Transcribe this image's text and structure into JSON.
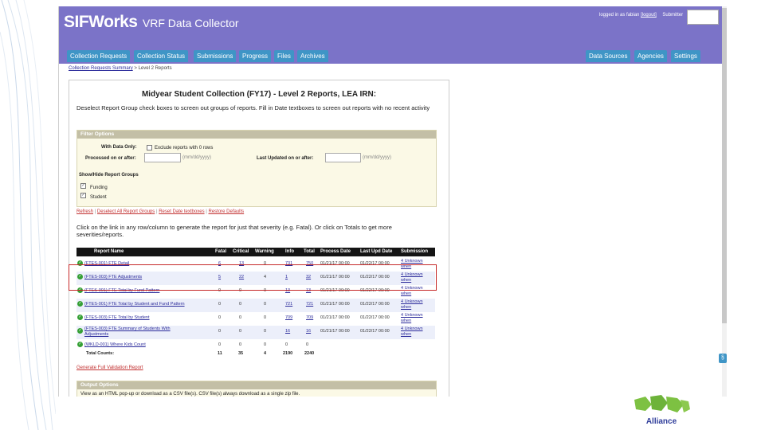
{
  "header": {
    "logo_main": "SIFWorks",
    "logo_sub": "VRF Data Collector",
    "login_prefix": "logged in as",
    "login_user": "fabian",
    "logout_label": "[logout]",
    "submitter_label": "Submitter"
  },
  "nav_left": [
    "Collection Requests",
    "Collection Status",
    "Submissions",
    "Progress",
    "Files",
    "Archives"
  ],
  "nav_right": [
    "Data Sources",
    "Agencies",
    "Settings"
  ],
  "breadcrumb": {
    "link": "Collection Requests Summary",
    "separator": ">",
    "current": "Level 2 Reports"
  },
  "page": {
    "title": "Midyear Student Collection (FY17) - Level 2 Reports, LEA IRN:",
    "intro": "Deselect Report Group check boxes to screen out groups of reports. Fill in Date textboxes to screen out reports with no recent activity"
  },
  "filter": {
    "heading": "Filter Options",
    "with_data_label": "With Data Only:",
    "exclude_label": "Exclude reports with 0 rows",
    "processed_label": "Processed on or after:",
    "date_hint": "(mm/dd/yyyy)",
    "updated_label": "Last Updated on or after:",
    "groups_label": "Show/Hide Report Groups",
    "group_funding": "Funding",
    "group_student": "Student"
  },
  "actions": [
    "Refresh",
    "Deselect All Report Groups",
    "Reset Date textboxes",
    "Restore Defaults"
  ],
  "action_separator": "|",
  "instructions": "Click on the link in any row/column to generate the report for just that severity (e.g. Fatal). Or click on Totals to get more severities/reports.",
  "table": {
    "headers": [
      "Report Name",
      "Fatal",
      "Critical",
      "Warning",
      "Info",
      "Total",
      "Process Date",
      "Last Upd Date",
      "Submission"
    ],
    "rows": [
      {
        "name": "(FTES-001) FTE Detail",
        "fatal": "6",
        "critical": "13",
        "warning": "0",
        "info": "731",
        "total": "750",
        "process": "01/21/17 00:00",
        "updated": "01/22/17 00:00",
        "submission": "4 Unknown",
        "submission2": "when"
      },
      {
        "name": "(FTES-003) FTE Adjustments",
        "fatal": "5",
        "critical": "22",
        "warning": "4",
        "info": "1",
        "total": "32",
        "process": "01/21/17 00:00",
        "updated": "01/22/17 00:00",
        "submission": "4 Unknown",
        "submission2": "when"
      },
      {
        "name": "(FTES-001) FTE Total by Fund Pattern",
        "fatal": "0",
        "critical": "0",
        "warning": "0",
        "info": "13",
        "total": "13",
        "process": "01/21/17 00:00",
        "updated": "01/22/17 00:00",
        "submission": "4 Unknown",
        "submission2": "when"
      },
      {
        "name": "(FTES-001) FTE Total by Student and Fund Pattern",
        "fatal": "0",
        "critical": "0",
        "warning": "0",
        "info": "721",
        "total": "721",
        "process": "01/21/17 00:00",
        "updated": "01/22/17 00:00",
        "submission": "4 Unknown",
        "submission2": "when"
      },
      {
        "name": "(FTES-003) FTE Total by Student",
        "fatal": "0",
        "critical": "0",
        "warning": "0",
        "info": "709",
        "total": "709",
        "process": "01/21/17 00:00",
        "updated": "01/22/17 00:00",
        "submission": "4 Unknown",
        "submission2": "when"
      },
      {
        "name": "(FTES-003) FTE Summary of Students With",
        "name2": "Adjustments",
        "fatal": "0",
        "critical": "0",
        "warning": "0",
        "info": "16",
        "total": "16",
        "process": "01/21/17 00:00",
        "updated": "01/22/17 00:00",
        "submission": "4 Unknown",
        "submission2": "when"
      },
      {
        "name": "(WKLD-001) Where Kids Count",
        "fatal": "0",
        "critical": "0",
        "warning": "0",
        "info": "0",
        "total": "0",
        "process": "",
        "updated": "",
        "submission": "",
        "submission2": ""
      }
    ],
    "totals": {
      "label": "Total Counts:",
      "fatal": "11",
      "critical": "35",
      "warning": "4",
      "info": "2190",
      "total": "2240"
    }
  },
  "generate_link": "Generate Full Validation Report",
  "output": {
    "heading": "Output Options",
    "description": "View as an HTML pop-up or download as a CSV file(s). CSV file(s) always download as a single zip file."
  },
  "footer_logo": {
    "text": "Alliance",
    "color": "#2f3d9a",
    "accent": "#7dc142"
  },
  "colors": {
    "header": "#7b73c8",
    "tab": "#3f95c6",
    "highlight": "#c62828",
    "ok": "#36a036"
  }
}
